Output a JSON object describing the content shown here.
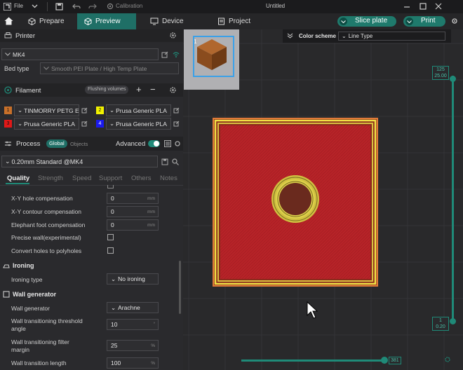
{
  "titlebar": {
    "file": "File",
    "calibration": "Calibration",
    "title": "Untitled"
  },
  "nav": {
    "prepare": "Prepare",
    "preview": "Preview",
    "device": "Device",
    "project": "Project",
    "slice": "Slice plate",
    "print": "Print"
  },
  "printer": {
    "header": "Printer",
    "name": "MK4",
    "bed_label": "Bed type",
    "bed_value": "Smooth PEI Plate / High Temp Plate"
  },
  "filament": {
    "header": "Filament",
    "flushing": "Flushing volumes",
    "add": "+",
    "remove": "−",
    "slots": [
      {
        "num": "1",
        "name": "TINMORRY PETG E...",
        "color": "#c8702a"
      },
      {
        "num": "2",
        "name": "Prusa Generic PLA",
        "color": "#f2f200"
      },
      {
        "num": "3",
        "name": "Prusa Generic PLA",
        "color": "#e01818"
      },
      {
        "num": "4",
        "name": "Prusa Generic PLA",
        "color": "#1a1aee"
      }
    ]
  },
  "process": {
    "header": "Process",
    "global": "Global",
    "objects": "Objects",
    "advanced": "Advanced",
    "preset": "0.20mm Standard @MK4"
  },
  "tabs": [
    "Quality",
    "Strength",
    "Speed",
    "Support",
    "Others",
    "Notes"
  ],
  "settings": {
    "xy_hole": {
      "label": "X-Y hole compensation",
      "value": "0",
      "unit": "mm"
    },
    "xy_contour": {
      "label": "X-Y contour compensation",
      "value": "0",
      "unit": "mm"
    },
    "elephant": {
      "label": "Elephant foot compensation",
      "value": "0",
      "unit": "mm"
    },
    "precise_wall": "Precise wall(experimental)",
    "convert_holes": "Convert holes to polyholes",
    "ironing_section": "Ironing",
    "ironing_type_label": "Ironing type",
    "ironing_type_value": "No ironing",
    "wallgen_section": "Wall generator",
    "wallgen_label": "Wall generator",
    "wallgen_value": "Arachne",
    "wt_angle_label1": "Wall transitioning threshold",
    "wt_angle_label2": "angle",
    "wt_angle_value": "10",
    "wt_filter_label1": "Wall transitioning filter",
    "wt_filter_label2": "margin",
    "wt_filter_value": "25",
    "wt_filter_unit": "%",
    "wt_length_label": "Wall transition length",
    "wt_length_value": "100",
    "wt_length_unit": "%"
  },
  "viewport": {
    "color_scheme_label": "Color scheme",
    "color_scheme_value": "Line Type",
    "thumb_num": "1",
    "layer_top": "125",
    "layer_top_h": "25.00",
    "layer_bottom": "1",
    "layer_bottom_h": "0.20",
    "move_value": "381"
  },
  "colors": {
    "accent": "#1f8a78",
    "model": "#c0282a",
    "perimeter": "#f0e040"
  }
}
